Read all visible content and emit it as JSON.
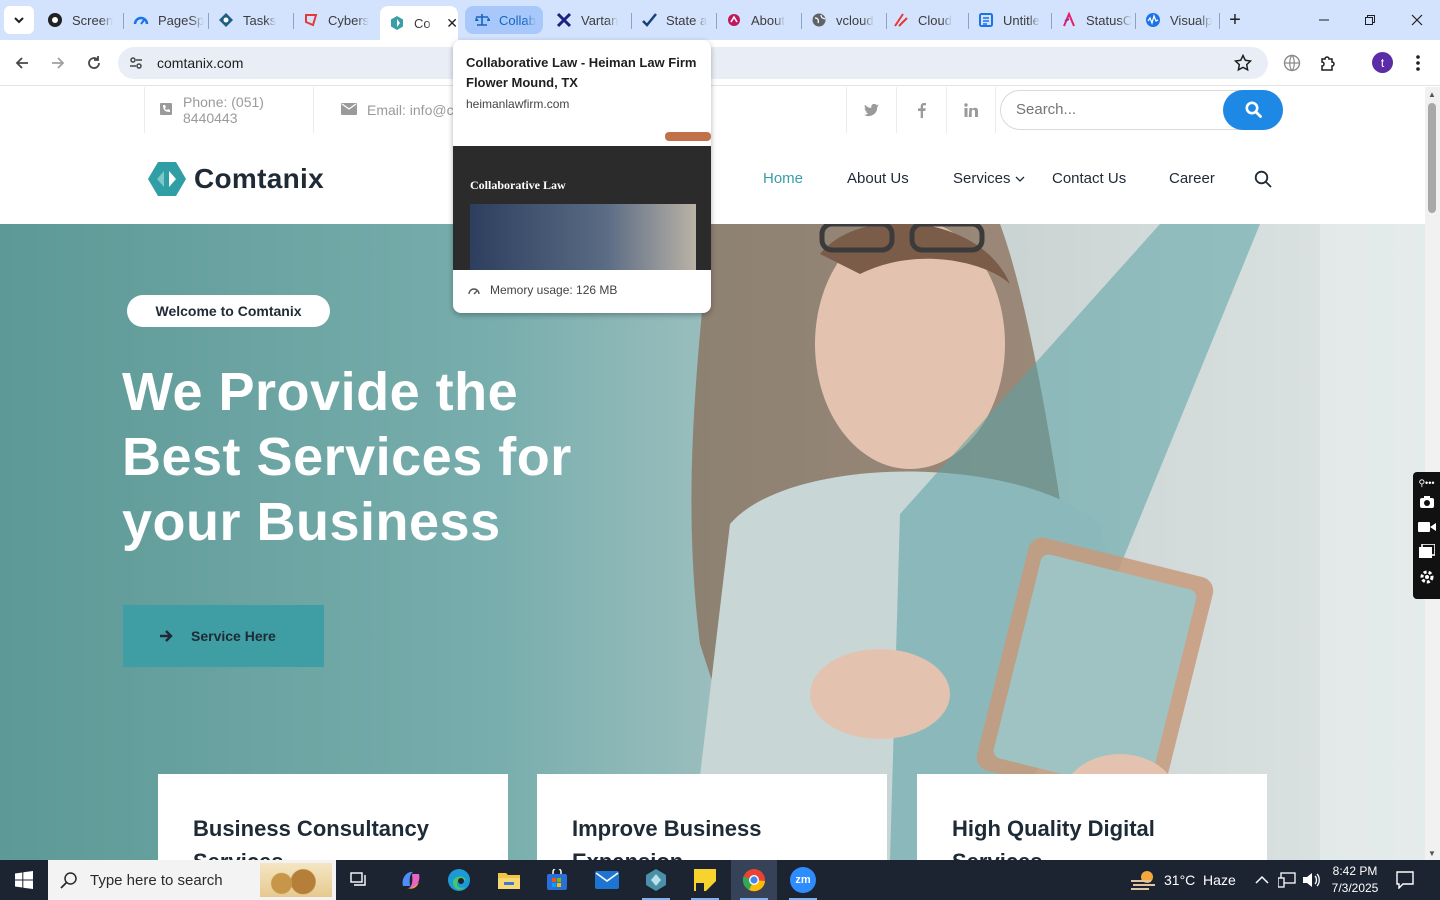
{
  "browser": {
    "tabs": [
      {
        "title": "Screen",
        "icon": "screencast-icon"
      },
      {
        "title": "PageSp",
        "icon": "pagespeed-icon"
      },
      {
        "title": "Tasks",
        "icon": "tasks-icon"
      },
      {
        "title": "Cybers",
        "icon": "cybersecurity-icon"
      },
      {
        "title": "Co",
        "icon": "comtanix-icon",
        "active": true
      },
      {
        "title": "Collab",
        "icon": "scales-icon",
        "hovered": true
      },
      {
        "title": "Vartan",
        "icon": "vartana-icon"
      },
      {
        "title": "State a",
        "icon": "checkmark-icon"
      },
      {
        "title": "About",
        "icon": "about-icon"
      },
      {
        "title": "vcloud",
        "icon": "globe-icon"
      },
      {
        "title": "Cloud",
        "icon": "cloud-icon"
      },
      {
        "title": "Untitle",
        "icon": "docs-icon"
      },
      {
        "title": "StatusC",
        "icon": "status-icon"
      },
      {
        "title": "Visualp",
        "icon": "visualping-icon"
      }
    ],
    "new_tab_symbol": "+",
    "url": "comtanix.com",
    "profile_initial": "t",
    "hover_card": {
      "title": "Collaborative Law - Heiman Law Firm Flower Mound, TX",
      "host": "heimanlawfirm.com",
      "preview_heading": "Collaborative Law",
      "memory": "Memory usage: 126 MB"
    }
  },
  "site": {
    "topbar": {
      "phone": "Phone: (051) 8440443",
      "email": "Email: info@co",
      "social": [
        "twitter-icon",
        "facebook-icon",
        "linkedin-icon"
      ],
      "search_placeholder": "Search..."
    },
    "logo_text": "Comtanix",
    "nav": [
      {
        "label": "Home",
        "active": true
      },
      {
        "label": "About Us"
      },
      {
        "label": "Services",
        "dropdown": true
      },
      {
        "label": "Contact Us"
      },
      {
        "label": "Career"
      }
    ],
    "hero": {
      "badge": "Welcome to Comtanix",
      "line1": "We Provide the",
      "line2": "Best Services for",
      "line3": "your Business",
      "button": "Service Here"
    },
    "cards": [
      {
        "l1": "Business Consultancy",
        "l2": "Services"
      },
      {
        "l1": "Improve Business",
        "l2": "Expansion"
      },
      {
        "l1": "High Quality Digital",
        "l2": "Services"
      }
    ]
  },
  "taskbar": {
    "search_placeholder": "Type here to search",
    "weather": "31°C  Haze",
    "time": "8:42 PM",
    "date": "7/3/2025"
  },
  "colors": {
    "accent": "#3f9ea3",
    "nav_active": "#3a9ea5",
    "search_btn": "#1e88e5",
    "tabstrip": "#d3e3fd"
  }
}
